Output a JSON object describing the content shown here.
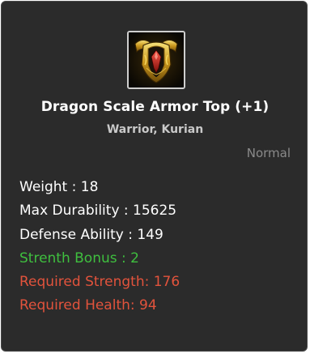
{
  "item": {
    "icon": "dragon-scale-armor-icon",
    "name": "Dragon Scale Armor Top (+1)",
    "classes": "Warrior, Kurian",
    "grade": "Normal"
  },
  "stats": [
    {
      "text": "Weight : 18",
      "kind": "normal"
    },
    {
      "text": "Max Durability : 15625",
      "kind": "normal"
    },
    {
      "text": "Defense Ability : 149",
      "kind": "normal"
    },
    {
      "text": "Strenth Bonus : 2",
      "kind": "bonus"
    },
    {
      "text": "Required Strength: 176",
      "kind": "requirement"
    },
    {
      "text": "Required Health: 94",
      "kind": "requirement"
    }
  ],
  "colors": {
    "panel_bg": "#2b2b2b",
    "normal": "#ffffff",
    "bonus": "#3fbf3f",
    "requirement": "#e2533c",
    "grade": "#8a8a8a"
  }
}
